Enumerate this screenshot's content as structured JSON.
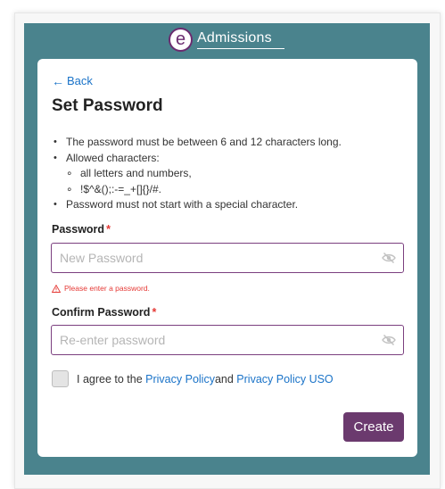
{
  "header": {
    "logo_letter": "e",
    "brand_name": "Admissions"
  },
  "card": {
    "back_label": "Back",
    "back_icon": "arrow-left-icon",
    "title": "Set Password",
    "rules": {
      "rule_length": "The password must be between 6 and 12 characters long.",
      "rule_allowed": "Allowed characters:",
      "rule_allowed_letters": "all letters and numbers,",
      "rule_allowed_specials": "!$^&();:-=_+[]{}/#.",
      "rule_no_special_start": "Password must not start with a special character."
    },
    "password": {
      "label": "Password",
      "required_mark": "*",
      "placeholder": "New Password",
      "value": "",
      "error": "Please enter a password."
    },
    "confirm_password": {
      "label": "Confirm Password",
      "required_mark": "*",
      "placeholder": "Re-enter password",
      "value": ""
    },
    "agree": {
      "prefix": "I agree to the",
      "link1": "Privacy Policy",
      "middle": "and",
      "link2": "Privacy Policy USO",
      "checked": false
    },
    "create_label": "Create"
  },
  "colors": {
    "panel": "#4a838d",
    "accent_purple": "#6b3a6e",
    "link_blue": "#1a73c8",
    "error_red": "#e53935"
  }
}
